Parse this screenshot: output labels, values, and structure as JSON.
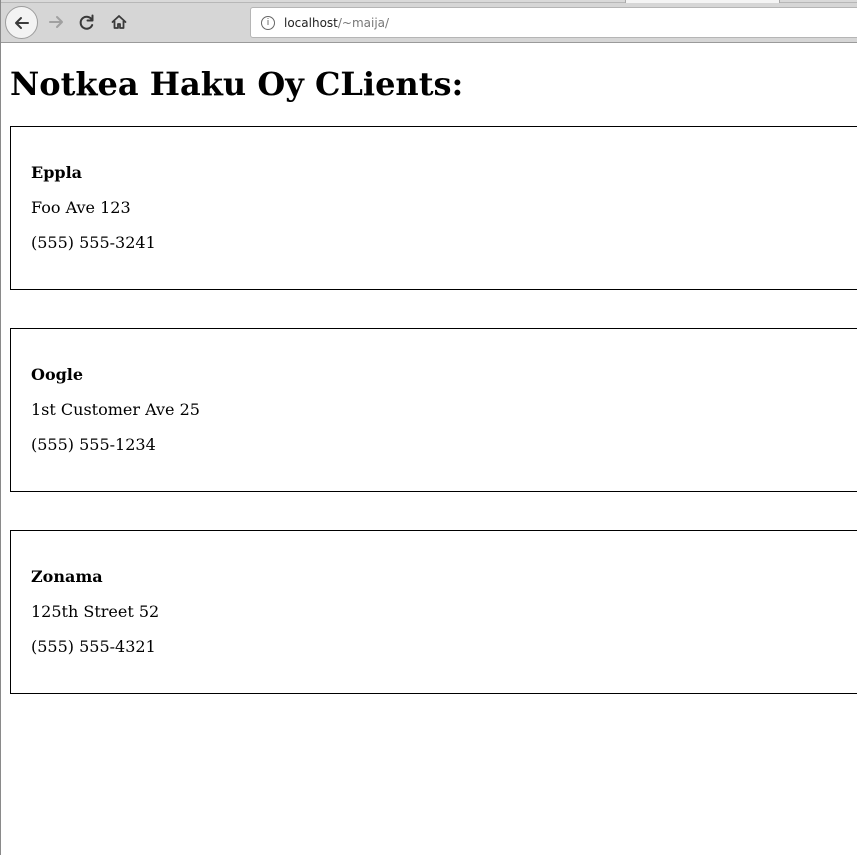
{
  "browser": {
    "url_host": "localhost",
    "url_path": "/~maija/",
    "buttons": {
      "back": "back-arrow",
      "forward": "forward-arrow",
      "reload": "reload",
      "home": "home"
    }
  },
  "page": {
    "title": "Notkea Haku Oy CLients:",
    "clients": [
      {
        "name": "Eppla",
        "address": "Foo Ave 123",
        "phone": "(555) 555-3241"
      },
      {
        "name": "Oogle",
        "address": "1st Customer Ave 25",
        "phone": "(555) 555-1234"
      },
      {
        "name": "Zonama",
        "address": "125th Street 52",
        "phone": "(555) 555-4321"
      }
    ]
  }
}
